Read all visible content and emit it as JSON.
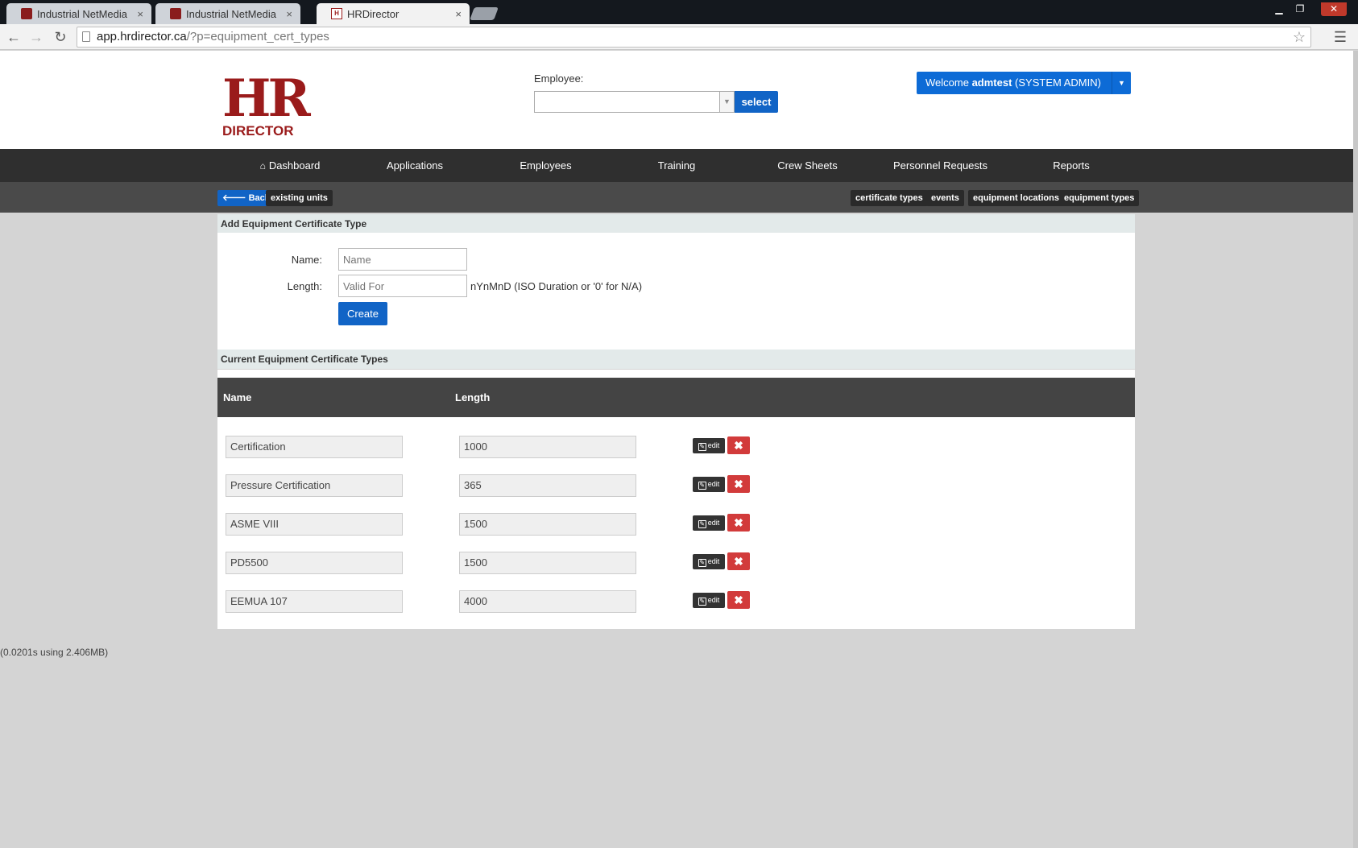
{
  "browser": {
    "tabs": [
      {
        "title": "Industrial NetMedia",
        "close": "×"
      },
      {
        "title": "Industrial NetMedia",
        "close": "×"
      },
      {
        "title": "HRDirector",
        "close": "×"
      }
    ],
    "url_host": "app.hrdirector.ca",
    "url_path": "/?p=equipment_cert_types",
    "window_controls": {
      "minimize": "▁",
      "maximize": "❐",
      "close": "✕"
    }
  },
  "logo": {
    "hr": "HR",
    "director": "DIRECTOR"
  },
  "employee": {
    "label": "Employee:",
    "select_button": "select"
  },
  "welcome": {
    "prefix": "Welcome ",
    "user": "admtest",
    "role": " (SYSTEM ADMIN)"
  },
  "nav": {
    "items": [
      "Dashboard",
      "Applications",
      "Employees",
      "Training",
      "Crew Sheets",
      "Personnel Requests",
      "Reports"
    ]
  },
  "subnav": {
    "back": "Back",
    "existing_units": "existing units",
    "certificate_types": "certificate types",
    "events": "events",
    "equipment_locations": "equipment locations",
    "equipment_types": "equipment types"
  },
  "add_form": {
    "title": "Add Equipment Certificate Type",
    "name_label": "Name:",
    "name_placeholder": "Name",
    "length_label": "Length:",
    "length_placeholder": "Valid For",
    "length_hint": "nYnMnD (ISO Duration or '0' for N/A)",
    "create_button": "Create"
  },
  "current": {
    "title": "Current Equipment Certificate Types",
    "columns": [
      "Name",
      "Length"
    ],
    "edit_label": "edit",
    "delete_label": "✖",
    "rows": [
      {
        "name": "Certification",
        "length": "1000"
      },
      {
        "name": "Pressure Certification",
        "length": "365"
      },
      {
        "name": "ASME VIII",
        "length": "1500"
      },
      {
        "name": "PD5500",
        "length": "1500"
      },
      {
        "name": "EEMUA 107",
        "length": "4000"
      }
    ]
  },
  "footer": {
    "timing": "(0.0201s using 2.406MB)"
  },
  "colors": {
    "brand": "#9a1b1b",
    "primary": "#1164c6",
    "danger": "#d23b3b",
    "nav": "#2f2f2f"
  }
}
